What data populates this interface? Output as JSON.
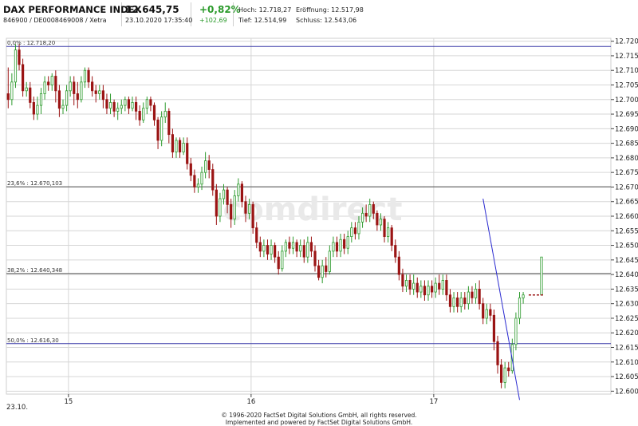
{
  "header": {
    "title": "DAX PERFORMANCE INDEX",
    "subtitle": "846900 / DE0008469008 / Xetra",
    "price": "12.645,75",
    "datetime": "23.10.2020 17:35:40",
    "change_pct": "+0,82%",
    "change_abs": "+102,69",
    "stats": [
      {
        "label": "Hoch:",
        "value": "12.718,27"
      },
      {
        "label": "Eröffnung:",
        "value": "12.517,98"
      },
      {
        "label": "Tief:",
        "value": "12.514,99"
      },
      {
        "label": "Schluss:",
        "value": "12.543,06"
      }
    ]
  },
  "footer": {
    "line1": "© 1996-2020 FactSet Digital Solutions GmbH, all rights reserved.",
    "line2": "Implemented and powered by FactSet Digital Solutions GmbH."
  },
  "colors": {
    "up": "#2e9b2e",
    "down": "#9b1414",
    "trendline": "#2a2ad0",
    "fib_blue": "#3a3aa8",
    "fib_black": "#555555"
  },
  "chart_data": {
    "type": "candlestick",
    "watermark": "comdirect",
    "date_label": "23.10.",
    "x_ticks": [
      {
        "label": "15",
        "x": 15
      },
      {
        "label": "16",
        "x": 16
      },
      {
        "label": "17",
        "x": 17
      }
    ],
    "xlim": [
      14.66,
      17.97
    ],
    "ylim": [
      12599,
      12721
    ],
    "y_ticks": [
      "12.600",
      "12.605",
      "12.610",
      "12.615",
      "12.620",
      "12.625",
      "12.630",
      "12.635",
      "12.640",
      "12.645",
      "12.650",
      "12.655",
      "12.660",
      "12.665",
      "12.670",
      "12.675",
      "12.680",
      "12.685",
      "12.690",
      "12.695",
      "12.700",
      "12.705",
      "12.710",
      "12.715",
      "12.720"
    ],
    "fib_levels": [
      {
        "label": "0,0% : 12.718,20",
        "value": 12718.2,
        "style": "blue"
      },
      {
        "label": "23,6% : 12.670,103",
        "value": 12670.1,
        "style": "black"
      },
      {
        "label": "38,2% : 12.640,348",
        "value": 12640.35,
        "style": "black"
      },
      {
        "label": "50,0% : 12.616,30",
        "value": 12616.3,
        "style": "blue"
      }
    ],
    "trendline": [
      [
        17.27,
        12666
      ],
      [
        17.47,
        12597
      ]
    ],
    "dashed_level": {
      "value": 12633,
      "from": 17.52,
      "to": 17.6
    },
    "candles": [
      [
        14.67,
        12702,
        12700,
        12711,
        12697
      ],
      [
        14.69,
        12700,
        12706,
        12709,
        12698
      ],
      [
        14.71,
        12706,
        12717,
        12719,
        12704
      ],
      [
        14.73,
        12717,
        12712,
        12719,
        12710
      ],
      [
        14.75,
        12712,
        12703,
        12714,
        12701
      ],
      [
        14.77,
        12703,
        12704,
        12706,
        12701
      ],
      [
        14.79,
        12704,
        12699,
        12706,
        12697
      ],
      [
        14.81,
        12699,
        12695,
        12701,
        12693
      ],
      [
        14.83,
        12695,
        12698,
        12701,
        12693
      ],
      [
        14.85,
        12698,
        12702,
        12704,
        12695
      ],
      [
        14.87,
        12702,
        12706,
        12708,
        12700
      ],
      [
        14.89,
        12706,
        12705,
        12708,
        12703
      ],
      [
        14.91,
        12705,
        12708,
        12709,
        12703
      ],
      [
        14.93,
        12708,
        12703,
        12710,
        12699
      ],
      [
        14.95,
        12703,
        12697,
        12705,
        12694
      ],
      [
        14.97,
        12697,
        12698,
        12700,
        12695
      ],
      [
        14.99,
        12698,
        12703,
        12705,
        12696
      ],
      [
        15.01,
        12703,
        12706,
        12708,
        12701
      ],
      [
        15.03,
        12706,
        12702,
        12708,
        12698
      ],
      [
        15.05,
        12702,
        12700,
        12706,
        12697
      ],
      [
        15.07,
        12700,
        12706,
        12708,
        12699
      ],
      [
        15.09,
        12706,
        12710,
        12711,
        12704
      ],
      [
        15.11,
        12710,
        12706,
        12711,
        12704
      ],
      [
        15.13,
        12706,
        12703,
        12708,
        12701
      ],
      [
        15.15,
        12703,
        12702,
        12705,
        12699
      ],
      [
        15.17,
        12702,
        12703,
        12705,
        12700
      ],
      [
        15.19,
        12703,
        12700,
        12705,
        12697
      ],
      [
        15.21,
        12700,
        12697,
        12702,
        12695
      ],
      [
        15.23,
        12697,
        12699,
        12702,
        12695
      ],
      [
        15.25,
        12699,
        12696,
        12700,
        12694
      ],
      [
        15.27,
        12696,
        12697,
        12699,
        12693
      ],
      [
        15.29,
        12697,
        12698,
        12700,
        12695
      ],
      [
        15.31,
        12698,
        12700,
        12701,
        12696
      ],
      [
        15.33,
        12700,
        12697,
        12701,
        12695
      ],
      [
        15.35,
        12697,
        12699,
        12701,
        12696
      ],
      [
        15.37,
        12699,
        12696,
        12701,
        12693
      ],
      [
        15.39,
        12696,
        12693,
        12698,
        12691
      ],
      [
        15.41,
        12693,
        12697,
        12699,
        12692
      ],
      [
        15.43,
        12697,
        12700,
        12701,
        12695
      ],
      [
        15.45,
        12700,
        12698,
        12701,
        12696
      ],
      [
        15.47,
        12698,
        12693,
        12699,
        12691
      ],
      [
        15.49,
        12693,
        12686,
        12694,
        12683
      ],
      [
        15.51,
        12686,
        12694,
        12696,
        12684
      ],
      [
        15.53,
        12694,
        12696,
        12699,
        12692
      ],
      [
        15.55,
        12696,
        12688,
        12697,
        12685
      ],
      [
        15.57,
        12688,
        12682,
        12690,
        12680
      ],
      [
        15.59,
        12682,
        12686,
        12687,
        12680
      ],
      [
        15.61,
        12686,
        12682,
        12687,
        12680
      ],
      [
        15.63,
        12682,
        12685,
        12687,
        12681
      ],
      [
        15.65,
        12685,
        12678,
        12687,
        12676
      ],
      [
        15.67,
        12678,
        12674,
        12680,
        12672
      ],
      [
        15.69,
        12674,
        12670,
        12676,
        12668
      ],
      [
        15.71,
        12670,
        12671,
        12673,
        12668
      ],
      [
        15.73,
        12671,
        12675,
        12677,
        12669
      ],
      [
        15.75,
        12675,
        12679,
        12682,
        12673
      ],
      [
        15.77,
        12679,
        12676,
        12681,
        12673
      ],
      [
        15.79,
        12676,
        12669,
        12678,
        12667
      ],
      [
        15.81,
        12669,
        12660,
        12671,
        12657
      ],
      [
        15.83,
        12660,
        12666,
        12668,
        12658
      ],
      [
        15.85,
        12666,
        12669,
        12671,
        12664
      ],
      [
        15.87,
        12669,
        12664,
        12670,
        12661
      ],
      [
        15.89,
        12664,
        12659,
        12666,
        12656
      ],
      [
        15.91,
        12659,
        12667,
        12669,
        12657
      ],
      [
        15.93,
        12667,
        12671,
        12673,
        12665
      ],
      [
        15.95,
        12671,
        12665,
        12672,
        12663
      ],
      [
        15.97,
        12665,
        12661,
        12667,
        12658
      ],
      [
        15.99,
        12661,
        12664,
        12666,
        12659
      ],
      [
        16.01,
        12664,
        12656,
        12665,
        12654
      ],
      [
        16.03,
        12656,
        12651,
        12658,
        12649
      ],
      [
        16.05,
        12651,
        12648,
        12653,
        12646
      ],
      [
        16.07,
        12648,
        12650,
        12652,
        12646
      ],
      [
        16.09,
        12650,
        12647,
        12652,
        12645
      ],
      [
        16.11,
        12647,
        12650,
        12652,
        12645
      ],
      [
        16.13,
        12650,
        12646,
        12651,
        12644
      ],
      [
        16.15,
        12646,
        12642,
        12648,
        12640
      ],
      [
        16.17,
        12642,
        12648,
        12650,
        12641
      ],
      [
        16.19,
        12648,
        12651,
        12652,
        12646
      ],
      [
        16.21,
        12651,
        12649,
        12653,
        12647
      ],
      [
        16.23,
        12649,
        12651,
        12653,
        12647
      ],
      [
        16.25,
        12651,
        12648,
        12652,
        12646
      ],
      [
        16.27,
        12648,
        12650,
        12652,
        12646
      ],
      [
        16.29,
        12650,
        12646,
        12652,
        12644
      ],
      [
        16.31,
        12646,
        12651,
        12653,
        12644
      ],
      [
        16.33,
        12651,
        12648,
        12653,
        12646
      ],
      [
        16.35,
        12648,
        12643,
        12650,
        12641
      ],
      [
        16.37,
        12643,
        12639,
        12645,
        12638
      ],
      [
        16.39,
        12639,
        12643,
        12645,
        12637
      ],
      [
        16.41,
        12643,
        12641,
        12646,
        12639
      ],
      [
        16.43,
        12641,
        12648,
        12650,
        12640
      ],
      [
        16.45,
        12648,
        12651,
        12653,
        12646
      ],
      [
        16.47,
        12651,
        12648,
        12653,
        12646
      ],
      [
        16.49,
        12648,
        12652,
        12654,
        12646
      ],
      [
        16.51,
        12652,
        12649,
        12654,
        12647
      ],
      [
        16.53,
        12649,
        12653,
        12655,
        12647
      ],
      [
        16.55,
        12653,
        12656,
        12658,
        12651
      ],
      [
        16.57,
        12656,
        12654,
        12658,
        12652
      ],
      [
        16.59,
        12654,
        12658,
        12660,
        12652
      ],
      [
        16.61,
        12658,
        12661,
        12663,
        12656
      ],
      [
        16.63,
        12661,
        12660,
        12664,
        12658
      ],
      [
        16.65,
        12660,
        12664,
        12666,
        12658
      ],
      [
        16.67,
        12664,
        12661,
        12665,
        12659
      ],
      [
        16.69,
        12661,
        12657,
        12662,
        12655
      ],
      [
        16.71,
        12657,
        12659,
        12661,
        12655
      ],
      [
        16.73,
        12659,
        12653,
        12660,
        12651
      ],
      [
        16.75,
        12653,
        12656,
        12658,
        12651
      ],
      [
        16.77,
        12656,
        12650,
        12657,
        12648
      ],
      [
        16.79,
        12650,
        12646,
        12652,
        12644
      ],
      [
        16.81,
        12646,
        12640,
        12648,
        12638
      ],
      [
        16.83,
        12640,
        12636,
        12642,
        12634
      ],
      [
        16.85,
        12636,
        12638,
        12640,
        12634
      ],
      [
        16.87,
        12638,
        12635,
        12640,
        12633
      ],
      [
        16.89,
        12635,
        12637,
        12640,
        12633
      ],
      [
        16.91,
        12637,
        12634,
        12639,
        12632
      ],
      [
        16.93,
        12634,
        12636,
        12638,
        12632
      ],
      [
        16.95,
        12636,
        12633,
        12638,
        12631
      ],
      [
        16.97,
        12633,
        12636,
        12638,
        12631
      ],
      [
        16.99,
        12636,
        12634,
        12638,
        12632
      ],
      [
        17.01,
        12634,
        12637,
        12639,
        12632
      ],
      [
        17.03,
        12637,
        12635,
        12640,
        12633
      ],
      [
        17.05,
        12635,
        12638,
        12640,
        12633
      ],
      [
        17.07,
        12638,
        12633,
        12640,
        12631
      ],
      [
        17.09,
        12633,
        12629,
        12635,
        12627
      ],
      [
        17.11,
        12629,
        12632,
        12634,
        12627
      ],
      [
        17.13,
        12632,
        12629,
        12634,
        12627
      ],
      [
        17.15,
        12629,
        12632,
        12634,
        12627
      ],
      [
        17.17,
        12632,
        12630,
        12634,
        12628
      ],
      [
        17.19,
        12630,
        12634,
        12636,
        12628
      ],
      [
        17.21,
        12634,
        12632,
        12636,
        12630
      ],
      [
        17.23,
        12632,
        12635,
        12637,
        12630
      ],
      [
        17.25,
        12635,
        12630,
        12638,
        12628
      ],
      [
        17.27,
        12630,
        12625,
        12632,
        12623
      ],
      [
        17.29,
        12625,
        12628,
        12630,
        12623
      ],
      [
        17.31,
        12628,
        12626,
        12630,
        12624
      ],
      [
        17.33,
        12626,
        12617,
        12628,
        12614
      ],
      [
        17.35,
        12617,
        12609,
        12619,
        12606
      ],
      [
        17.37,
        12609,
        12603,
        12611,
        12601
      ],
      [
        17.39,
        12603,
        12608,
        12610,
        12601
      ],
      [
        17.41,
        12608,
        12607,
        12610,
        12605
      ],
      [
        17.43,
        12607,
        12616,
        12618,
        12606
      ],
      [
        17.45,
        12616,
        12625,
        12627,
        12614
      ],
      [
        17.47,
        12625,
        12632,
        12634,
        12623
      ],
      [
        17.49,
        12632,
        12633,
        12634,
        12630
      ],
      [
        17.59,
        12633,
        12646,
        12646,
        12633
      ]
    ]
  }
}
